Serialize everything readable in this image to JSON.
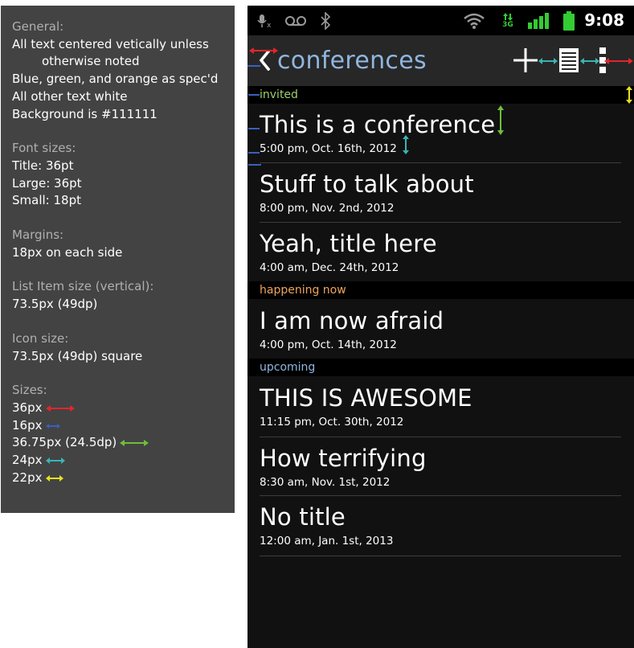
{
  "spec": {
    "general": {
      "heading": "General:",
      "lines": [
        "All text centered vetically unless",
        "otherwise noted",
        "Blue, green, and orange as spec'd",
        "All other text white",
        "Background is #111111"
      ]
    },
    "font_sizes": {
      "heading": "Font sizes:",
      "lines": [
        "Title: 36pt",
        "Large: 36pt",
        "Small: 18pt"
      ]
    },
    "margins": {
      "heading": "Margins:",
      "lines": [
        "18px on each side"
      ]
    },
    "list_item": {
      "heading": "List Item size (vertical):",
      "lines": [
        "73.5px (49dp)"
      ]
    },
    "icon_size": {
      "heading": "Icon size:",
      "lines": [
        "73.5px (49dp) square"
      ]
    },
    "sizes": {
      "heading": "Sizes:",
      "items": [
        {
          "label": "36px",
          "color": "#e0262b"
        },
        {
          "label": "16px",
          "color": "#3a5fbf"
        },
        {
          "label": "36.75px (24.5dp)",
          "color": "#6fbf3a"
        },
        {
          "label": "24px",
          "color": "#3bb3b3"
        },
        {
          "label": "22px",
          "color": "#e8e020"
        }
      ]
    }
  },
  "phone": {
    "status_bar": {
      "time": "9:08",
      "network_label": "3G",
      "icons": [
        "mic-muted-icon",
        "voicemail-icon",
        "bluetooth-icon",
        "wifi-icon",
        "data-3g-icon",
        "signal-icon",
        "battery-icon"
      ]
    },
    "action_bar": {
      "title": "conferences",
      "icons": [
        "back-chevron-icon",
        "add-icon",
        "list-icon",
        "overflow-menu-icon"
      ]
    },
    "sections": [
      {
        "header": "invited",
        "color": "#9fcf6a",
        "items": [
          {
            "title": "This is a conference",
            "date": "5:00 pm, Oct. 16th, 2012"
          },
          {
            "title": "Stuff to talk about",
            "date": "8:00 pm, Nov. 2nd, 2012"
          },
          {
            "title": "Yeah, title here",
            "date": "4:00 am, Dec. 24th, 2012"
          }
        ]
      },
      {
        "header": "happening now",
        "color": "#f0a35a",
        "items": [
          {
            "title": "I am now afraid",
            "date": "4:00 pm, Oct. 14th, 2012"
          }
        ]
      },
      {
        "header": "upcoming",
        "color": "#8fb6df",
        "items": [
          {
            "title": "THIS IS AWESOME",
            "date": "11:15 pm, Oct. 30th, 2012"
          },
          {
            "title": "How terrifying",
            "date": "8:30 am, Nov. 1st, 2012"
          },
          {
            "title": "No title",
            "date": "12:00 am, Jan. 1st, 2013"
          }
        ]
      }
    ],
    "colors": {
      "background": "#111111",
      "title_blue": "#8fb6df",
      "invited_green": "#9fcf6a",
      "now_orange": "#f0a35a"
    }
  }
}
